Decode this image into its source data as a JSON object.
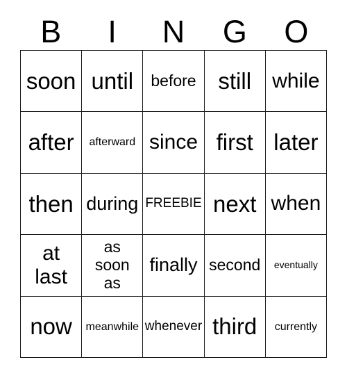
{
  "card": {
    "header_letters": [
      "B",
      "I",
      "N",
      "G",
      "O"
    ],
    "free_space_label": "FREEBIE",
    "grid": {
      "rows": 5,
      "columns": 5,
      "cells": [
        [
          {
            "text": "soon",
            "size": "fs-xxl"
          },
          {
            "text": "until",
            "size": "fs-xxl"
          },
          {
            "text": "before",
            "size": "fs-md"
          },
          {
            "text": "still",
            "size": "fs-xxl"
          },
          {
            "text": "while",
            "size": "fs-xl"
          }
        ],
        [
          {
            "text": "after",
            "size": "fs-xxl"
          },
          {
            "text": "afterward",
            "size": "fs-xs"
          },
          {
            "text": "since",
            "size": "fs-xl"
          },
          {
            "text": "first",
            "size": "fs-xxl"
          },
          {
            "text": "later",
            "size": "fs-xxl"
          }
        ],
        [
          {
            "text": "then",
            "size": "fs-xxl"
          },
          {
            "text": "during",
            "size": "fs-lg"
          },
          {
            "text": "FREEBIE",
            "size": "fs-sm"
          },
          {
            "text": "next",
            "size": "fs-xxl"
          },
          {
            "text": "when",
            "size": "fs-xl"
          }
        ],
        [
          {
            "text": "at\nlast",
            "size": "fs-xl",
            "multiline": true
          },
          {
            "text": "as\nsoon\nas",
            "size": "fs-md",
            "multiline": true
          },
          {
            "text": "finally",
            "size": "fs-lg"
          },
          {
            "text": "second",
            "size": "fs-md"
          },
          {
            "text": "eventually",
            "size": "fs-xxs"
          }
        ],
        [
          {
            "text": "now",
            "size": "fs-xxl"
          },
          {
            "text": "meanwhile",
            "size": "fs-xs"
          },
          {
            "text": "whenever",
            "size": "fs-sm"
          },
          {
            "text": "third",
            "size": "fs-xxl"
          },
          {
            "text": "currently",
            "size": "fs-xs"
          }
        ]
      ]
    },
    "colors": {
      "background": "#ffffff",
      "text": "#000000",
      "border": "#1a1a1a"
    }
  }
}
